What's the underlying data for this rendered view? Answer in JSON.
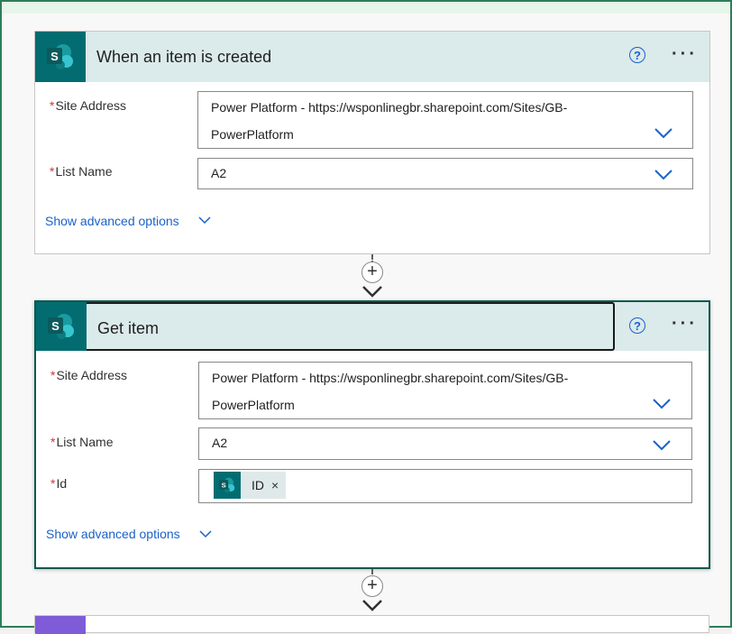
{
  "trigger": {
    "title": "When an item is created",
    "fields": {
      "site_address_label": "Site Address",
      "site_address_value_line1": "Power Platform - https://wsponlinegbr.sharepoint.com/Sites/GB-",
      "site_address_value_line2": "PowerPlatform",
      "list_name_label": "List Name",
      "list_name_value": "A2"
    },
    "advanced_options": "Show advanced options"
  },
  "action": {
    "title": "Get item",
    "fields": {
      "site_address_label": "Site Address",
      "site_address_value_line1": "Power Platform - https://wsponlinegbr.sharepoint.com/Sites/GB-",
      "site_address_value_line2": "PowerPlatform",
      "list_name_label": "List Name",
      "list_name_value": "A2",
      "id_label": "Id",
      "id_token": "ID"
    },
    "advanced_options": "Show advanced options"
  },
  "common": {
    "required_mark": "*",
    "help_glyph": "?",
    "more_glyph": "···",
    "plus_glyph": "+",
    "remove_token_glyph": "×",
    "sharepoint_letter": "S"
  },
  "icons": {
    "connector": "sharepoint-icon",
    "help": "help-icon",
    "more": "more-options-icon",
    "dropdown": "chevron-down-icon"
  },
  "colors": {
    "sharepoint": "#036c70",
    "header_bg": "#dbeaea",
    "link": "#1a62c9",
    "required": "#d13438",
    "frame": "#2e7d5b",
    "next_card_accent": "#7e5cd8"
  }
}
